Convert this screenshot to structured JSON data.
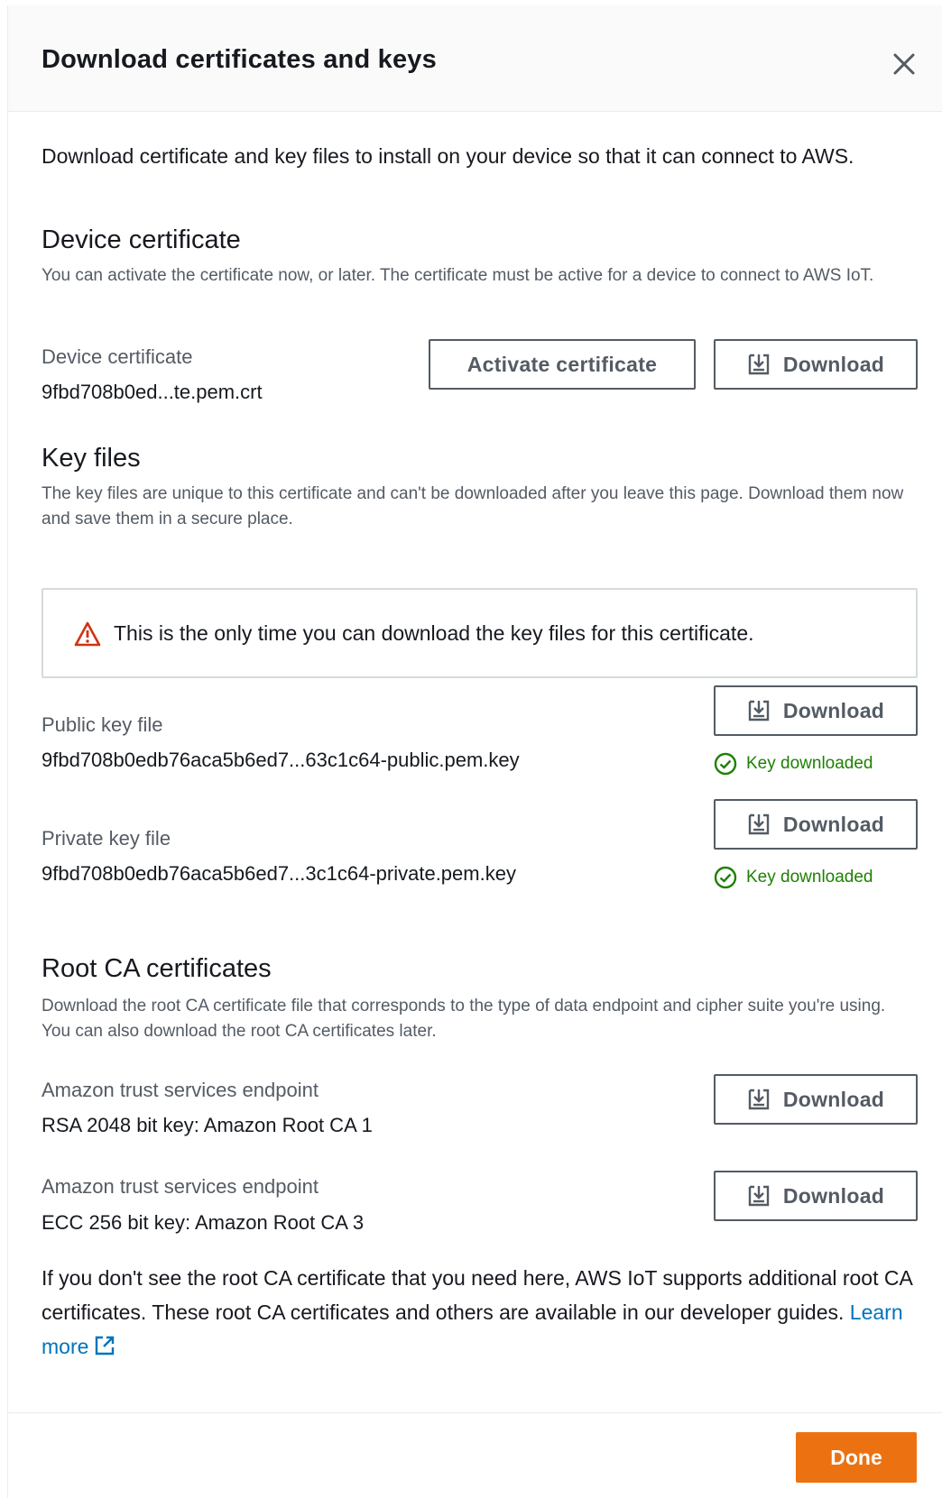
{
  "modal": {
    "title": "Download certificates and keys",
    "intro": "Download certificate and key files to install on your device so that it can connect to AWS."
  },
  "device_certificate": {
    "heading": "Device certificate",
    "description": "You can activate the certificate now, or later. The certificate must be active for a device to connect to AWS IoT.",
    "label": "Device certificate",
    "filename": "9fbd708b0ed...te.pem.crt",
    "activate_label": "Activate certificate",
    "download_label": "Download"
  },
  "key_files": {
    "heading": "Key files",
    "description": "The key files are unique to this certificate and can't be downloaded after you leave this page. Download them now and save them in a secure place.",
    "alert_text": "This is the only time you can download the key files for this certificate.",
    "public": {
      "label": "Public key file",
      "filename": "9fbd708b0edb76aca5b6ed7...63c1c64-public.pem.key",
      "download_label": "Download",
      "status": "Key downloaded"
    },
    "private": {
      "label": "Private key file",
      "filename": "9fbd708b0edb76aca5b6ed7...3c1c64-private.pem.key",
      "download_label": "Download",
      "status": "Key downloaded"
    }
  },
  "root_ca": {
    "heading": "Root CA certificates",
    "description": "Download the root CA certificate file that corresponds to the type of data endpoint and cipher suite you're using. You can also download the root CA certificates later.",
    "items": [
      {
        "label": "Amazon trust services endpoint",
        "value": "RSA 2048 bit key: Amazon Root CA 1",
        "download_label": "Download"
      },
      {
        "label": "Amazon trust services endpoint",
        "value": "ECC 256 bit key: Amazon Root CA 3",
        "download_label": "Download"
      }
    ],
    "footer_text": "If you don't see the root CA certificate that you need here, AWS IoT supports additional root CA certificates. These root CA certificates and others are available in our developer guides.",
    "learn_more": "Learn more"
  },
  "footer": {
    "done_label": "Done"
  },
  "colors": {
    "primary": "#ec7211",
    "link": "#0073bb",
    "success": "#1d8102",
    "warning": "#d13212"
  },
  "icons": {
    "close": "close-icon",
    "download": "download-icon",
    "warning": "warning-icon",
    "success": "check-circle-icon",
    "external": "external-link-icon"
  }
}
